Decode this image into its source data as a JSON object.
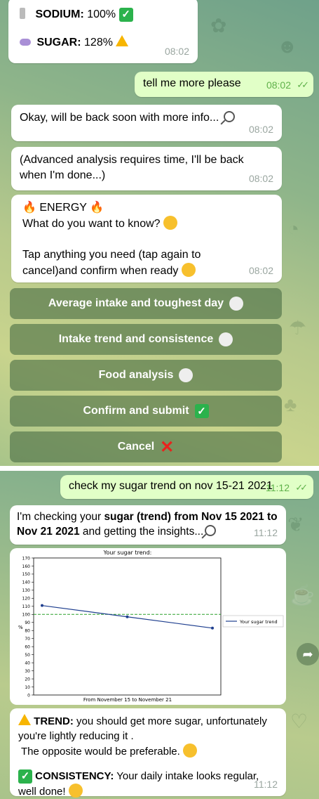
{
  "panel1": {
    "summary": {
      "sodium_label": "SODIUM:",
      "sodium_value": "100%",
      "sugar_label": "SUGAR:",
      "sugar_value": "128%",
      "time": "08:02"
    },
    "msg_user": {
      "text": "tell me more please",
      "time": "08:02"
    },
    "msg_wait": {
      "text": "Okay, will be back soon with more info...",
      "time": "08:02"
    },
    "msg_advanced": {
      "text": "(Advanced analysis requires time, I'll be back when I'm done...)",
      "time": "08:02"
    },
    "msg_energy": {
      "title": "ENERGY",
      "question": "What do you want to know?",
      "instructions": "Tap anything you need (tap again to cancel)and confirm when ready",
      "time": "08:02"
    },
    "buttons": {
      "average": "Average intake and toughest day",
      "trend": "Intake trend and consistence",
      "food": "Food analysis",
      "confirm": "Confirm and submit",
      "cancel": "Cancel"
    }
  },
  "panel2": {
    "msg_user": {
      "text": "check my sugar trend on nov 15-21 2021",
      "time": "11:12"
    },
    "msg_checking": {
      "pre": "I'm checking your ",
      "bold1": "sugar (trend) from Nov 15 2021 to Nov 21 2021",
      "post": " and getting the insights...",
      "time": "11:12"
    },
    "msg_result": {
      "trend_label": "TREND:",
      "trend_text": " you should get more sugar, unfortunately you're lightly reducing it .",
      "opposite": "The opposite would be preferable.",
      "consistency_label": "CONSISTENCY:",
      "consistency_text": " Your daily intake looks regular, well done!",
      "time": "11:12"
    }
  },
  "chart_data": {
    "type": "line",
    "title": "Your sugar trend:",
    "xlabel": "From November 15 to November 21",
    "ylabel": "%",
    "ylim": [
      0,
      170
    ],
    "yticks": [
      "0",
      "10",
      "20",
      "30",
      "40",
      "50",
      "60",
      "70",
      "80",
      "90",
      "100",
      "110",
      "120",
      "130",
      "140",
      "150",
      "160",
      "170"
    ],
    "series": [
      {
        "name": "Your sugar trend",
        "x": [
          0,
          1,
          2
        ],
        "values": [
          111,
          97,
          83
        ],
        "color": "#1f3f8f"
      }
    ],
    "reference_line": {
      "value": 100,
      "color": "#2ca02c"
    },
    "legend": "right"
  },
  "colors": {
    "accent_green": "#5fb14a",
    "outgoing_bubble": "#e1ffc7",
    "button_bg": "#4a6e46"
  },
  "icons": {
    "share": "share-arrow-icon"
  }
}
